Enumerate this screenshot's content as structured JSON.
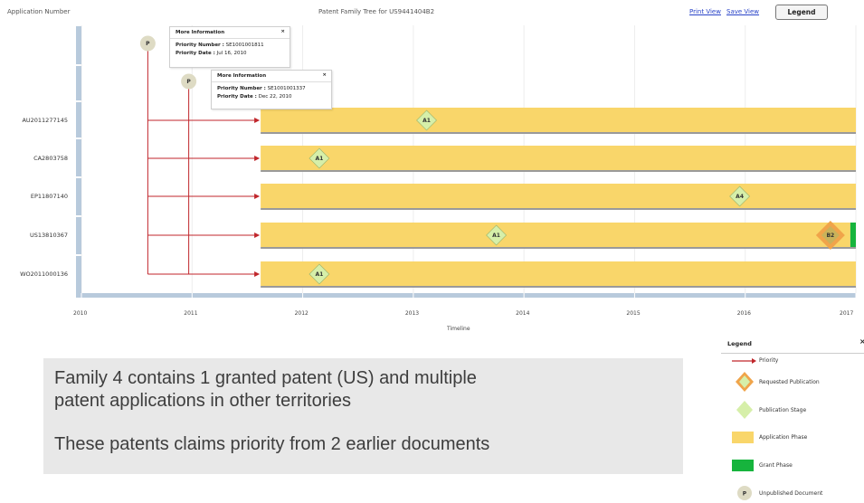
{
  "header": {
    "application_number_label": "Application Number",
    "title": "Patent Family Tree for  US9441404B2",
    "print_view": "Print View",
    "save_view": "Save View",
    "legend_button": "Legend"
  },
  "timeline": {
    "axis_label": "Timeline",
    "years": [
      "2010",
      "2011",
      "2012",
      "2013",
      "2014",
      "2015",
      "2016",
      "2017"
    ],
    "year_start": 2010,
    "year_end": 2017
  },
  "priorities": [
    {
      "marker": "P",
      "date": 2010.6
    },
    {
      "marker": "P",
      "date": 2010.97
    }
  ],
  "rows": [
    {
      "label": "AU2011277145",
      "phase_start": 2011.62,
      "grant_start": null,
      "markers": [
        {
          "label": "A1",
          "date": 2013.12,
          "kind": "publication"
        }
      ]
    },
    {
      "label": "CA2803758",
      "phase_start": 2011.62,
      "grant_start": null,
      "markers": [
        {
          "label": "A1",
          "date": 2012.15,
          "kind": "publication"
        }
      ]
    },
    {
      "label": "EP11807140",
      "phase_start": 2011.62,
      "grant_start": null,
      "markers": [
        {
          "label": "A4",
          "date": 2015.95,
          "kind": "publication"
        }
      ]
    },
    {
      "label": "US13810367",
      "phase_start": 2011.62,
      "grant_start": 2016.95,
      "markers": [
        {
          "label": "A1",
          "date": 2013.75,
          "kind": "publication"
        },
        {
          "label": "B2",
          "date": 2016.77,
          "kind": "requested"
        }
      ]
    },
    {
      "label": "WO2011000136",
      "phase_start": 2011.62,
      "grant_start": null,
      "markers": [
        {
          "label": "A1",
          "date": 2012.15,
          "kind": "publication"
        }
      ]
    }
  ],
  "popups": [
    {
      "title": "More Information",
      "priority_number_label": "Priority Number :",
      "priority_number": "SE1001001811",
      "priority_date_label": "Priority Date :",
      "priority_date": "Jul 16, 2010"
    },
    {
      "title": "More Information",
      "priority_number_label": "Priority Number :",
      "priority_number": "SE1001001337",
      "priority_date_label": "Priority Date :",
      "priority_date": "Dec 22, 2010"
    }
  ],
  "caption": {
    "line1": "Family 4 contains 1 granted patent (US) and multiple",
    "line2": "patent applications in other territories",
    "line3": "These patents claims priority from 2 earlier documents"
  },
  "legend": {
    "title": "Legend",
    "close": "×",
    "items": [
      {
        "label": "Priority",
        "icon": "priority-arrow"
      },
      {
        "label": "Requested Publication",
        "icon": "orange-diamond"
      },
      {
        "label": "Publication Stage",
        "icon": "green-diamond"
      },
      {
        "label": "Application Phase",
        "icon": "yellow-bar"
      },
      {
        "label": "Grant Phase",
        "icon": "green-bar"
      },
      {
        "label": "Unpublished Document",
        "icon": "p-circle",
        "marker": "P"
      }
    ]
  },
  "colors": {
    "application_phase": "#f9d66a",
    "grant_phase": "#16b43d",
    "publication_diamond": "#d6efa9",
    "requested_diamond": "#f0a44a",
    "priority_line": "#c0262b",
    "axis": "#b8cadc",
    "link": "#2a44c8"
  }
}
